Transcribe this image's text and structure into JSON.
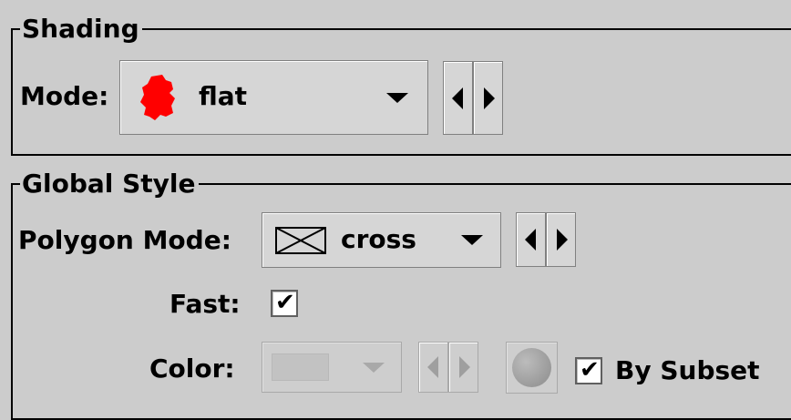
{
  "shading": {
    "legend": "Shading",
    "mode_label": "Mode:",
    "mode_value": "flat",
    "mode_icon": "red-blob-icon",
    "accent_color": "#ff0000"
  },
  "global_style": {
    "legend": "Global Style",
    "polygon_mode_label": "Polygon Mode:",
    "polygon_mode_value": "cross",
    "polygon_icon": "cross-box-icon",
    "fast_label": "Fast:",
    "fast_checked": true,
    "color_label": "Color:",
    "color_enabled": false,
    "by_subset_label": "By Subset",
    "by_subset_checked": true
  },
  "icons": {
    "check_mark": "✔"
  }
}
